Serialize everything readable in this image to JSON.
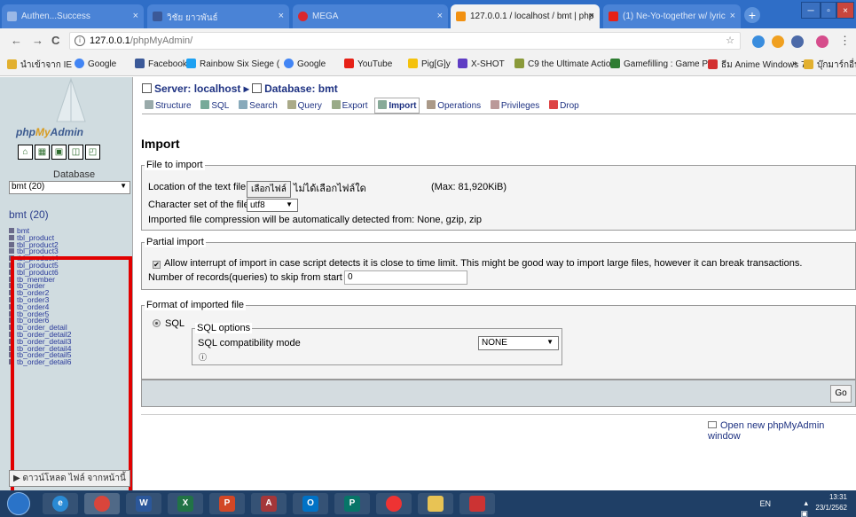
{
  "browser": {
    "tabs": [
      {
        "title": "Authen...Success",
        "active": false
      },
      {
        "title": "วิชัย ยาวพันธ์",
        "active": false
      },
      {
        "title": "MEGA",
        "active": false
      },
      {
        "title": "127.0.0.1 / localhost / bmt | php",
        "active": true
      },
      {
        "title": "(1) Ne-Yo-together w/ lyric",
        "active": false
      }
    ],
    "url_host": "127.0.0.1",
    "url_path": "/phpMyAdmin/",
    "bookmarks": [
      "นำเข้าจาก IE",
      "Google",
      "Facebook",
      "Rainbow Six Siege (",
      "Google",
      "YouTube",
      "Pig[G]y",
      "X-SHOT",
      "C9 the Ultimate Actio",
      "Gamefilling : Game P",
      "ธีม Anime Windows 7",
      "บุ๊กมาร์กอื่นๆ"
    ],
    "bookmarks_more": "»"
  },
  "left": {
    "logo_php": "php",
    "logo_my": "My",
    "logo_admin": "Admin",
    "database_label": "Database",
    "db_select_value": "bmt (20)",
    "db_title": "bmt (20)",
    "tables": [
      "bmt",
      "tbl_product",
      "tbl_product2",
      "tbl_product3",
      "tbl_product4",
      "tbl_product5",
      "tbl_product6",
      "tb_member",
      "tb_order",
      "tb_order2",
      "tb_order3",
      "tb_order4",
      "tb_order5",
      "tb_order6",
      "tb_order_detail",
      "tb_order_detail2",
      "tb_order_detail3",
      "tb_order_detail4",
      "tb_order_detail5",
      "tb_order_detail6"
    ],
    "download_label": "ดาวน์โหลด ไฟล์ จากหน้านี้"
  },
  "main": {
    "crumb_server": "Server: localhost",
    "crumb_db": "Database: bmt",
    "menu_tabs": [
      "Structure",
      "SQL",
      "Search",
      "Query",
      "Export",
      "Import",
      "Operations",
      "Privileges",
      "Drop"
    ],
    "menu_active": "Import",
    "page_title": "Import",
    "file_fieldset": "File to import",
    "location_label": "Location of the text file",
    "choose_file_btn": "เลือกไฟล์",
    "no_file_text": "ไม่ได้เลือกไฟล์ใด",
    "max_size": "(Max: 81,920KiB)",
    "charset_label": "Character set of the file:",
    "charset_value": "utf8",
    "compression_note": "Imported file compression will be automatically detected from: None, gzip, zip",
    "partial_fieldset": "Partial import",
    "allow_interrupt": "Allow interrupt of import in case script detects it is close to time limit. This might be good way to import large files, however it can break transactions.",
    "skip_label": "Number of records(queries) to skip from start",
    "skip_value": "0",
    "format_fieldset": "Format of imported file",
    "format_sql": "SQL",
    "sql_options_legend": "SQL options",
    "compat_label": "SQL compatibility mode",
    "compat_value": "NONE",
    "go_label": "Go",
    "open_new_window": "Open new phpMyAdmin window"
  },
  "taskbar": {
    "lang": "EN",
    "time": "13:31",
    "date": "23/1/2562"
  },
  "colors": {
    "titlebar": "#2f6ec7",
    "left_frame": "#d0dce0",
    "highlight_box": "#e10000",
    "link": "#1e3282"
  }
}
